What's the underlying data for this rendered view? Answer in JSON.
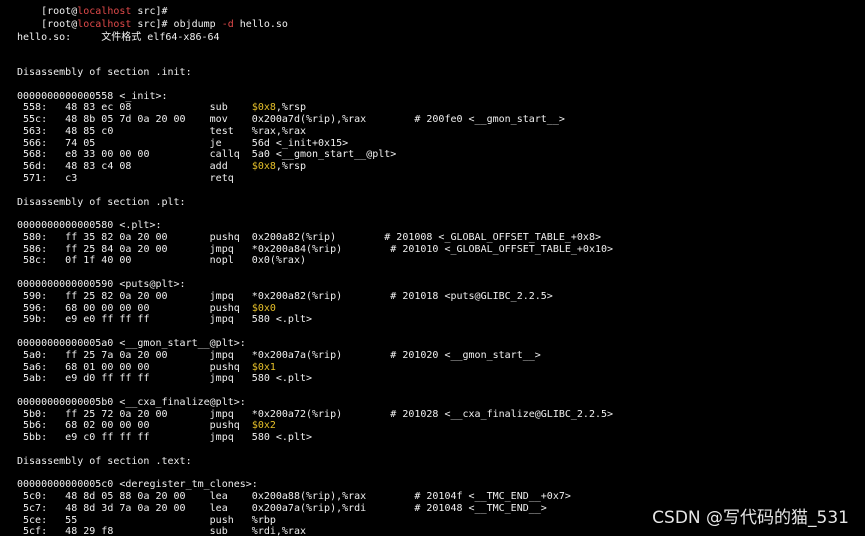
{
  "prompt_prev": {
    "pre": "[root@",
    "host": "localhost",
    "post": " src]#"
  },
  "prompt_cmd": {
    "pre": "[root@",
    "host": "localhost",
    "mid": " src]# objdump ",
    "flag": "-d",
    "post": " hello.so"
  },
  "file_line": "hello.so:     文件格式 elf64-x86-64",
  "lines": [
    {
      "y": 1,
      "parts": [
        {
          "t": "Disassembly of section .init:"
        }
      ]
    },
    {
      "y": 3,
      "parts": [
        {
          "t": "0000000000000558 <_init>:"
        }
      ]
    },
    {
      "y": 4,
      "parts": [
        {
          "t": " 558:\t48 83 ec 08          \tsub    "
        },
        {
          "t": "$0x8",
          "c": "imm"
        },
        {
          "t": ",%rsp"
        }
      ]
    },
    {
      "y": 5,
      "parts": [
        {
          "t": " 55c:\t48 8b 05 7d 0a 20 00 \tmov    0x200a7d(%rip),%rax        # 200fe0 <__gmon_start__>"
        }
      ]
    },
    {
      "y": 6,
      "parts": [
        {
          "t": " 563:\t48 85 c0             \ttest   %rax,%rax"
        }
      ]
    },
    {
      "y": 7,
      "parts": [
        {
          "t": " 566:\t74 05                \tje     56d <_init+0x15>"
        }
      ]
    },
    {
      "y": 8,
      "parts": [
        {
          "t": " 568:\te8 33 00 00 00       \tcallq  5a0 <__gmon_start__@plt>"
        }
      ]
    },
    {
      "y": 9,
      "parts": [
        {
          "t": " 56d:\t48 83 c4 08          \tadd    "
        },
        {
          "t": "$0x8",
          "c": "imm"
        },
        {
          "t": ",%rsp"
        }
      ]
    },
    {
      "y": 10,
      "parts": [
        {
          "t": " 571:\tc3                   \tretq   "
        }
      ]
    },
    {
      "y": 12,
      "parts": [
        {
          "t": "Disassembly of section .plt:"
        }
      ]
    },
    {
      "y": 14,
      "parts": [
        {
          "t": "0000000000000580 <.plt>:"
        }
      ]
    },
    {
      "y": 15,
      "parts": [
        {
          "t": " 580:\tff 35 82 0a 20 00    \tpushq  0x200a82(%rip)        # 201008 <_GLOBAL_OFFSET_TABLE_+0x8>"
        }
      ]
    },
    {
      "y": 16,
      "parts": [
        {
          "t": " 586:\tff 25 84 0a 20 00    \tjmpq   *0x200a84(%rip)        # 201010 <_GLOBAL_OFFSET_TABLE_+0x10>"
        }
      ]
    },
    {
      "y": 17,
      "parts": [
        {
          "t": " 58c:\t0f 1f 40 00          \tnopl   0x0(%rax)"
        }
      ]
    },
    {
      "y": 19,
      "parts": [
        {
          "t": "0000000000000590 <puts@plt>:"
        }
      ]
    },
    {
      "y": 20,
      "parts": [
        {
          "t": " 590:\tff 25 82 0a 20 00    \tjmpq   *0x200a82(%rip)        # 201018 <puts@GLIBC_2.2.5>"
        }
      ]
    },
    {
      "y": 21,
      "parts": [
        {
          "t": " 596:\t68 00 00 00 00       \tpushq  "
        },
        {
          "t": "$0x0",
          "c": "imm"
        }
      ]
    },
    {
      "y": 22,
      "parts": [
        {
          "t": " 59b:\te9 e0 ff ff ff       \tjmpq   580 <.plt>"
        }
      ]
    },
    {
      "y": 24,
      "parts": [
        {
          "t": "00000000000005a0 <__gmon_start__@plt>:"
        }
      ]
    },
    {
      "y": 25,
      "parts": [
        {
          "t": " 5a0:\tff 25 7a 0a 20 00    \tjmpq   *0x200a7a(%rip)        # 201020 <__gmon_start__>"
        }
      ]
    },
    {
      "y": 26,
      "parts": [
        {
          "t": " 5a6:\t68 01 00 00 00       \tpushq  "
        },
        {
          "t": "$0x1",
          "c": "imm"
        }
      ]
    },
    {
      "y": 27,
      "parts": [
        {
          "t": " 5ab:\te9 d0 ff ff ff       \tjmpq   580 <.plt>"
        }
      ]
    },
    {
      "y": 29,
      "parts": [
        {
          "t": "00000000000005b0 <__cxa_finalize@plt>:"
        }
      ]
    },
    {
      "y": 30,
      "parts": [
        {
          "t": " 5b0:\tff 25 72 0a 20 00    \tjmpq   *0x200a72(%rip)        # 201028 <__cxa_finalize@GLIBC_2.2.5>"
        }
      ]
    },
    {
      "y": 31,
      "parts": [
        {
          "t": " 5b6:\t68 02 00 00 00       \tpushq  "
        },
        {
          "t": "$0x2",
          "c": "imm"
        }
      ]
    },
    {
      "y": 32,
      "parts": [
        {
          "t": " 5bb:\te9 c0 ff ff ff       \tjmpq   580 <.plt>"
        }
      ]
    },
    {
      "y": 34,
      "parts": [
        {
          "t": "Disassembly of section .text:"
        }
      ]
    },
    {
      "y": 36,
      "parts": [
        {
          "t": "00000000000005c0 <deregister_tm_clones>:"
        }
      ]
    },
    {
      "y": 37,
      "parts": [
        {
          "t": " 5c0:\t48 8d 05 88 0a 20 00 \tlea    0x200a88(%rip),%rax        # 20104f <__TMC_END__+0x7>"
        }
      ]
    },
    {
      "y": 38,
      "parts": [
        {
          "t": " 5c7:\t48 8d 3d 7a 0a 20 00 \tlea    0x200a7a(%rip),%rdi        # 201048 <__TMC_END__>"
        }
      ]
    },
    {
      "y": 39,
      "parts": [
        {
          "t": " 5ce:\t55                   \tpush   %rbp"
        }
      ]
    },
    {
      "y": 40,
      "parts": [
        {
          "t": " 5cf:\t48 29 f8             \tsub    %rdi,%rax"
        }
      ]
    }
  ],
  "watermark": "CSDN @写代码的猫_531"
}
